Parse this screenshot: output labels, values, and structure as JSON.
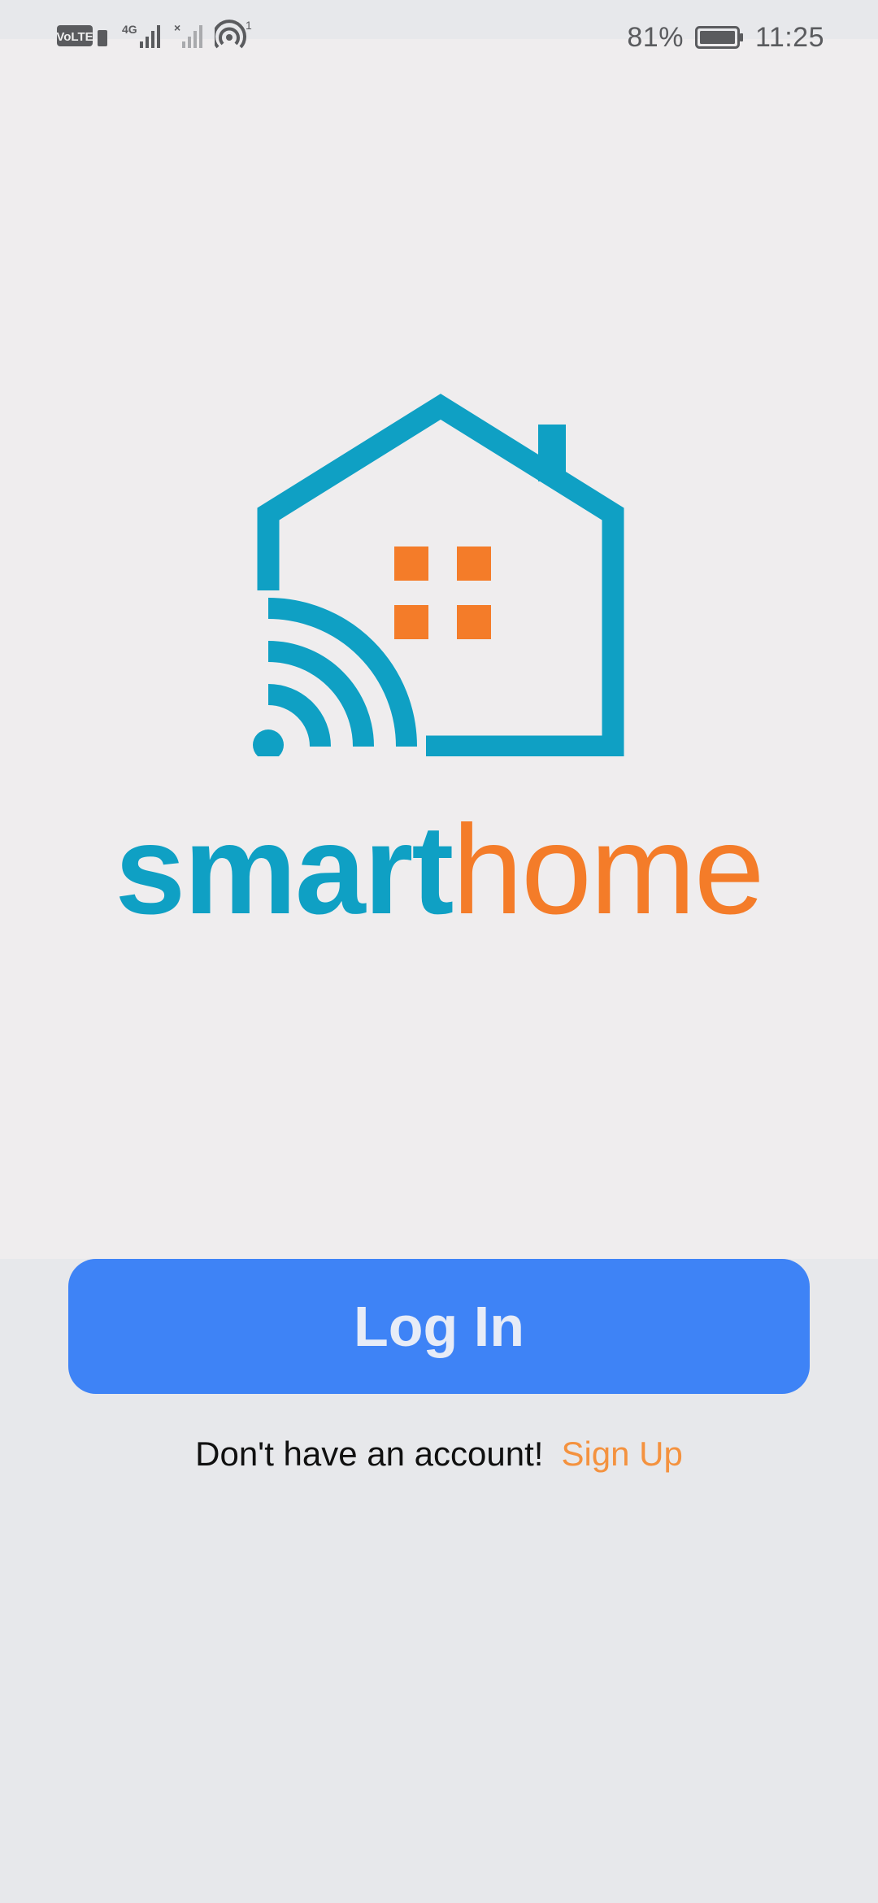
{
  "status_bar": {
    "volte_label": "VoLTE",
    "network_label": "4G",
    "hotspot_count": "1",
    "battery_percent": "81%",
    "time": "11:25",
    "icons": [
      "volte-icon",
      "signal-icon",
      "signal-off-icon",
      "hotspot-icon",
      "battery-icon"
    ]
  },
  "logo": {
    "word_primary": "smart",
    "word_secondary": "home",
    "colors": {
      "primary": "#0FA0C4",
      "accent": "#F47C29"
    },
    "icons": [
      "house-outline-icon",
      "window-icon",
      "wifi-signal-icon"
    ]
  },
  "actions": {
    "login_label": "Log In",
    "signup_prompt": "Don't have an account!",
    "signup_link": "Sign Up",
    "colors": {
      "button": "#3E83F6",
      "link": "#F4923F"
    }
  }
}
